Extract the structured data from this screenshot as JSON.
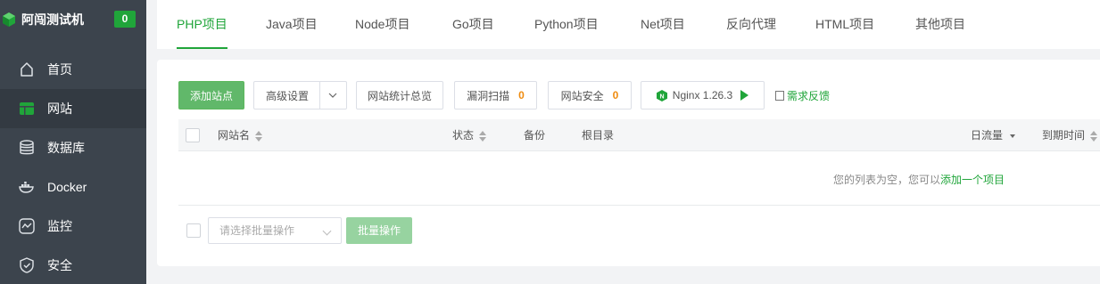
{
  "sidebar": {
    "brand": "阿闯测试机",
    "badge": "0",
    "items": [
      {
        "label": "首页",
        "icon": "home-icon"
      },
      {
        "label": "网站",
        "icon": "website-icon",
        "active": true
      },
      {
        "label": "数据库",
        "icon": "database-icon"
      },
      {
        "label": "Docker",
        "icon": "docker-icon"
      },
      {
        "label": "监控",
        "icon": "monitor-icon"
      },
      {
        "label": "安全",
        "icon": "shield-icon"
      }
    ]
  },
  "tabs": [
    {
      "label": "PHP项目",
      "active": true
    },
    {
      "label": "Java项目"
    },
    {
      "label": "Node项目"
    },
    {
      "label": "Go项目"
    },
    {
      "label": "Python项目"
    },
    {
      "label": "Net项目"
    },
    {
      "label": "反向代理"
    },
    {
      "label": "HTML项目"
    },
    {
      "label": "其他项目"
    }
  ],
  "toolbar": {
    "add_site": "添加站点",
    "advanced": "高级设置",
    "stats": "网站统计总览",
    "vuln_scan": "漏洞扫描",
    "vuln_count": "0",
    "site_security": "网站安全",
    "security_count": "0",
    "nginx": "Nginx 1.26.3",
    "feedback": "需求反馈"
  },
  "table": {
    "columns": {
      "name": "网站名",
      "status": "状态",
      "backup": "备份",
      "root": "根目录",
      "traffic": "日流量",
      "expire": "到期时间"
    },
    "empty_prefix": "您的列表为空，您可以",
    "empty_link": "添加一个项目"
  },
  "batch": {
    "placeholder": "请选择批量操作",
    "button": "批量操作"
  },
  "colors": {
    "accent": "#20a53a",
    "sidebar_bg": "#3c444d",
    "count": "#ef8b0f"
  }
}
